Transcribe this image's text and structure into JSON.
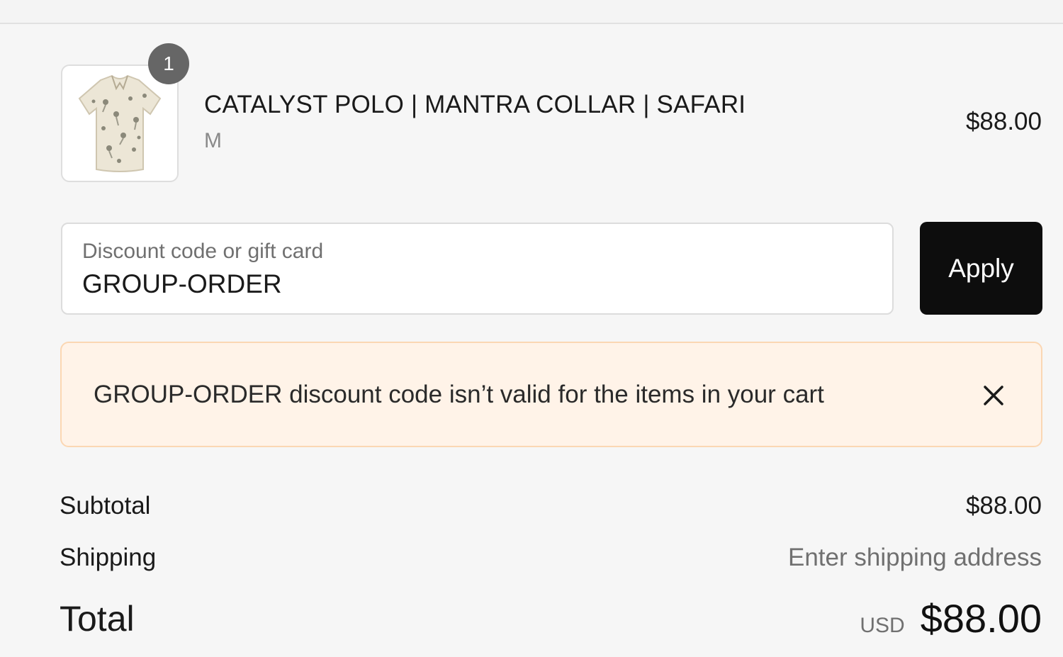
{
  "cart": {
    "item": {
      "quantity": "1",
      "title": "CATALYST POLO | MANTRA COLLAR | SAFARI",
      "variant": "M",
      "price": "$88.00",
      "image_icon": "shirt-thumbnail"
    }
  },
  "discount": {
    "label": "Discount code or gift card",
    "value": "GROUP-ORDER",
    "apply_label": "Apply"
  },
  "alert": {
    "message": "GROUP-ORDER discount code isn’t valid for the items in your cart",
    "close_icon": "close-icon",
    "background": "#fff3e8",
    "border": "#fbd7b3"
  },
  "summary": {
    "subtotal_label": "Subtotal",
    "subtotal_value": "$88.00",
    "shipping_label": "Shipping",
    "shipping_value": "Enter shipping address",
    "total_label": "Total",
    "currency": "USD",
    "total_value": "$88.00"
  },
  "colors": {
    "button_bg": "#0d0d0d",
    "page_bg": "#f6f6f6"
  }
}
